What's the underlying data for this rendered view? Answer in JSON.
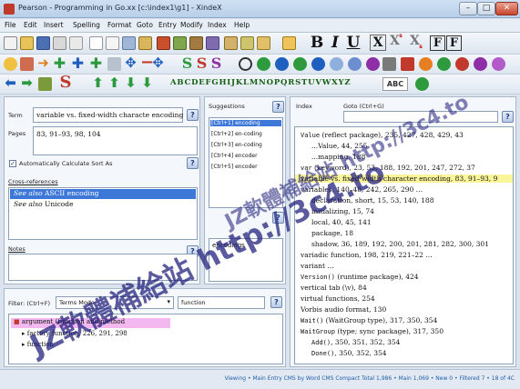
{
  "window": {
    "title": "Pearson - Programming in Go.xx [c:\\index1\\g1] - XindeX",
    "minimize": "–",
    "maximize": "□",
    "close": "✕"
  },
  "menu": [
    "File",
    "Edit",
    "Insert",
    "Spelling",
    "Format",
    "Goto",
    "Entry",
    "Modify",
    "Index",
    "Help"
  ],
  "toolbar": {
    "bold": "B",
    "italic": "I",
    "underline": "U",
    "cross": "X",
    "superscript": "X",
    "superscript_mark": "s",
    "subscript": "X",
    "subscript_mark": "s",
    "format_f": "F",
    "format_f2": "F",
    "abc_label": "ABC",
    "alphabet": "ABCDEFGHIJKLMNOPQRSTUVWXYZ",
    "colors": {
      "blue": "#1f5fbf",
      "red": "#c0392b",
      "green": "#2e9a3e",
      "purple": "#8e2fa8",
      "orange": "#e67e22"
    }
  },
  "entry": {
    "term_label": "Term",
    "term_value": "variable vs. fixed-width characte encoding",
    "pages_label": "Pages",
    "pages_value": "83, 91–93, 98, 104",
    "auto_sort_label": "Automatically Calculate Sort As",
    "auto_sort_checked": true,
    "crossrefs_label": "Cross-references",
    "crossrefs": [
      {
        "prefix": "See also",
        "text": "ASCII encoding",
        "selected": true
      },
      {
        "prefix": "See also",
        "text": "Unicode",
        "selected": false
      }
    ],
    "notes_label": "Notes",
    "help": "?"
  },
  "suggestions": {
    "label": "Suggestions",
    "items": [
      "[Ctrl+1] encoding",
      "[Ctrl+2] en-coding",
      "[Ctrl+3] en-coding",
      "[Ctrl+4] encoder",
      "[Ctrl+5] encoder"
    ],
    "lower_item": "encodings"
  },
  "filter": {
    "label": "Filter: (Ctrl+F)",
    "mode": "Terms Mode",
    "value": "function",
    "results": [
      {
        "text": "argument (function and method",
        "highlight": true
      },
      {
        "text": "factory function, 226, 291, 298",
        "highlight": false
      },
      {
        "text": "function",
        "highlight": false
      }
    ]
  },
  "index_panel": {
    "label": "Index",
    "goto_label": "Goto (Ctrl+G)",
    "entries": [
      {
        "text": "Value (reflect package), 235, 427, 428, 429, 43",
        "mono_prefix": "Value",
        "indent": false,
        "highlight": false
      },
      {
        "text": "...Value, 44, 255",
        "mono_prefix": "",
        "indent": true,
        "highlight": false
      },
      {
        "text": "...mapping, 188",
        "mono_prefix": "",
        "indent": true,
        "highlight": false
      },
      {
        "text": "var (keyword), 23, 53, 188, 192, 201, 247, 272, 37",
        "mono_prefix": "var",
        "indent": false,
        "highlight": false
      },
      {
        "text": "variable vs. fixed-width character encoding, 83, 91–93, 9",
        "mono_prefix": "",
        "indent": false,
        "highlight": true
      },
      {
        "text": "variables, 140–48, 242, 265, 290 …",
        "mono_prefix": "",
        "indent": false,
        "highlight": false
      },
      {
        "text": "declaration, short, 15, 53, 140, 188",
        "mono_prefix": "",
        "indent": true,
        "highlight": false
      },
      {
        "text": "initializing, 15, 74",
        "mono_prefix": "",
        "indent": true,
        "highlight": false
      },
      {
        "text": "local, 40, 45, 141",
        "mono_prefix": "",
        "indent": true,
        "highlight": false
      },
      {
        "text": "package, 18",
        "mono_prefix": "",
        "indent": true,
        "highlight": false
      },
      {
        "text": "shadow, 36, 189, 192, 200, 201, 281, 282, 300, 301",
        "mono_prefix": "",
        "indent": true,
        "highlight": false
      },
      {
        "text": "variadic function, 198, 219, 221–22 …",
        "mono_prefix": "",
        "indent": false,
        "highlight": false
      },
      {
        "text": "variant …",
        "mono_prefix": "",
        "indent": false,
        "highlight": false
      },
      {
        "text": "Version() (runtime package), 424",
        "mono_prefix": "Version()",
        "indent": false,
        "highlight": false
      },
      {
        "text": "vertical tab (\\v), 84",
        "mono_prefix": "",
        "indent": false,
        "highlight": false
      },
      {
        "text": "virtual functions, 254",
        "mono_prefix": "",
        "indent": false,
        "highlight": false
      },
      {
        "text": "Vorbis audio format, 130",
        "mono_prefix": "",
        "indent": false,
        "highlight": false
      },
      {
        "text": "Wait() (WaitGroup type), 317, 350, 354",
        "mono_prefix": "Wait()",
        "indent": false,
        "highlight": false
      },
      {
        "text": "WaitGroup (type; sync package), 317, 350",
        "mono_prefix": "WaitGroup",
        "indent": false,
        "highlight": false
      },
      {
        "text": "Add(), 350, 351, 352, 354",
        "mono_prefix": "Add()",
        "indent": true,
        "highlight": false
      },
      {
        "text": "Done(), 350, 352, 354",
        "mono_prefix": "Done()",
        "indent": true,
        "highlight": false
      }
    ]
  },
  "status": {
    "text": "Viewing • Main Entry CMS by Word CMS Compact Total 1,986 • Main 1,069 • New 0 • Filtered 7 • 18 of 4C"
  },
  "watermarks": {
    "text_1": "JZ軟體補給站 http://3c4.to",
    "text_2": "JZ軟體補給站 http://3c4.to"
  }
}
